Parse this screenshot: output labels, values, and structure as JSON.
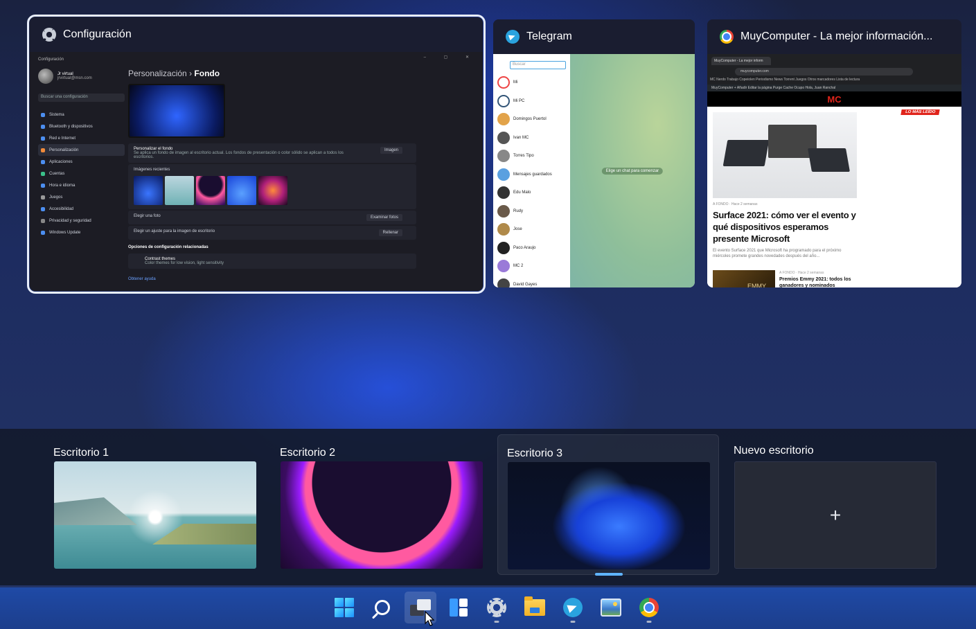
{
  "windows": [
    {
      "title": "Configuración",
      "app_icon": "settings-gear-icon",
      "selected": true,
      "preview": {
        "window_caption": "Configuración",
        "user_name": "Jr virtual",
        "user_email": "jrvirtual@msn.com",
        "search_placeholder": "Buscar una configuración",
        "nav": [
          "Sistema",
          "Bluetooth y dispositivos",
          "Red e Internet",
          "Personalización",
          "Aplicaciones",
          "Cuentas",
          "Hora e idioma",
          "Juegos",
          "Accesibilidad",
          "Privacidad y seguridad",
          "Windows Update"
        ],
        "breadcrumb_parent": "Personalización",
        "breadcrumb_sep": "›",
        "breadcrumb_current": "Fondo",
        "personalize_title": "Personalizar el fondo",
        "personalize_desc": "Se aplica un fondo de imagen al escritorio actual. Los fondos de presentación o color sólido se aplican a todos los escritorios.",
        "personalize_value": "Imagen",
        "recent_images_label": "Imágenes recientes",
        "choose_photo_label": "Elegir una foto",
        "choose_photo_button": "Examinar fotos",
        "fit_label": "Elegir un ajuste para la imagen de escritorio",
        "fit_value": "Rellenar",
        "related_section": "Opciones de configuración relacionadas",
        "contrast_title": "Contrast themes",
        "contrast_desc": "Color themes for low vision, light sensitivity",
        "help_link": "Obtener ayuda"
      }
    },
    {
      "title": "Telegram",
      "app_icon": "telegram-icon",
      "selected": false,
      "preview": {
        "search_placeholder": "Buscar",
        "chats": [
          "Mi",
          "Mi PC",
          "Domingos Puertol",
          "Ivan MC",
          "Torres Tipo",
          "Mensajes guardados",
          "Edu Malo",
          "Rudy",
          "Jose",
          "Paco Araujo",
          "MC 2",
          "David Gayes"
        ],
        "empty_state": "Elige un chat para comenzar"
      }
    },
    {
      "title": "MuyComputer - La mejor información...",
      "app_icon": "chrome-icon",
      "selected": false,
      "preview": {
        "tab_title": "MuyComputer - La mejor inform",
        "url": "muycomputer.com",
        "bookmarks": "MC  Nerdo  Trabajo  Copeiolen  Periodismo  News  Torrent  Juegos  Otros marcadores  Lista de lectura",
        "wp_bar": "MuyComputer  + Añadir  Editar la página  Purge Cache  Ocupo   Hola, Juan Ranchal",
        "site_logo": "MC",
        "badge": "LO MÁS LEÍDO",
        "kicker": "A FONDO · Hace 2 semanas",
        "headline": "Surface 2021: cómo ver el evento y qué dispositivos esperamos presente Microsoft",
        "lede": "El evento Surface 2021 que Microsoft ha programado para el próximo miércoles promete grandes novedades después del año...",
        "second_thumb_text": "EMMY",
        "second_kicker": "A FONDO · Hace 2 semanas",
        "second_headline": "Premios Emmy 2021: todos los ganadores y nominados"
      }
    }
  ],
  "desktops": [
    {
      "label": "Escritorio 1",
      "wallpaper": "lake-sunrise",
      "active": false
    },
    {
      "label": "Escritorio 2",
      "wallpaper": "purple-glow",
      "active": false
    },
    {
      "label": "Escritorio 3",
      "wallpaper": "blue-bloom",
      "active": true
    },
    {
      "label": "Nuevo escritorio",
      "wallpaper": "new",
      "active": false,
      "plus": "+"
    }
  ],
  "taskbar": {
    "items": [
      {
        "name": "start-icon",
        "running": false
      },
      {
        "name": "search-icon",
        "running": false
      },
      {
        "name": "task-view-icon",
        "running": false,
        "focused": true
      },
      {
        "name": "widgets-icon",
        "running": false
      },
      {
        "name": "settings-gear-icon",
        "running": true
      },
      {
        "name": "file-explorer-icon",
        "running": false
      },
      {
        "name": "telegram-icon",
        "running": true
      },
      {
        "name": "photos-icon",
        "running": false
      },
      {
        "name": "chrome-icon",
        "running": true
      }
    ]
  },
  "colors": {
    "accent": "#5fb4ff",
    "taskbar": "#1f4aa6",
    "strip": "#141a2c"
  }
}
